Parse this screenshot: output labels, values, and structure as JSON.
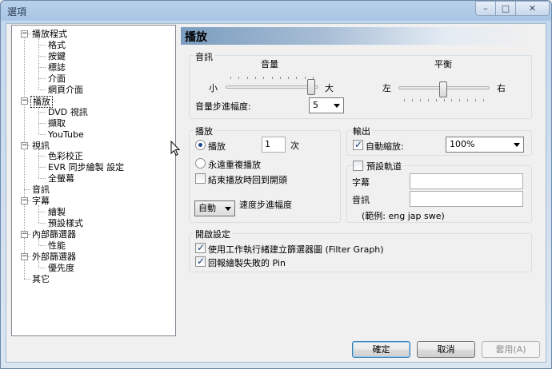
{
  "window": {
    "title": "選項"
  },
  "tree": {
    "items": [
      {
        "label": "播放程式",
        "level": 0,
        "expanded": true
      },
      {
        "label": "格式",
        "level": 1
      },
      {
        "label": "按鍵",
        "level": 1
      },
      {
        "label": "標誌",
        "level": 1
      },
      {
        "label": "介面",
        "level": 1
      },
      {
        "label": "網頁介面",
        "level": 1
      },
      {
        "label": "播放",
        "level": 0,
        "expanded": true,
        "selected": true
      },
      {
        "label": "DVD 視訊",
        "level": 1
      },
      {
        "label": "擷取",
        "level": 1
      },
      {
        "label": "YouTube",
        "level": 1
      },
      {
        "label": "視訊",
        "level": 0,
        "expanded": true
      },
      {
        "label": "色彩校正",
        "level": 1
      },
      {
        "label": "EVR 同步繪製 設定",
        "level": 1
      },
      {
        "label": "全螢幕",
        "level": 1
      },
      {
        "label": "音訊",
        "level": 0
      },
      {
        "label": "字幕",
        "level": 0,
        "expanded": true
      },
      {
        "label": "繪製",
        "level": 1
      },
      {
        "label": "預設樣式",
        "level": 1
      },
      {
        "label": "內部篩選器",
        "level": 0,
        "expanded": true
      },
      {
        "label": "性能",
        "level": 1
      },
      {
        "label": "外部篩選器",
        "level": 0,
        "expanded": true
      },
      {
        "label": "優先度",
        "level": 1
      },
      {
        "label": "其它",
        "level": 0
      }
    ]
  },
  "panel": {
    "title": "播放",
    "audio": {
      "group_label": "音訊",
      "volume_label": "音量",
      "volume_min": "小",
      "volume_max": "大",
      "volume_level": 1.0,
      "balance_label": "平衡",
      "balance_left": "左",
      "balance_right": "右",
      "balance_level": 0.5,
      "step_label": "音量步進幅度:",
      "step_value": "5"
    },
    "playback": {
      "group_label": "播放",
      "play_label": "播放",
      "play_count": "1",
      "times_label": "次",
      "repeat_forever_label": "永遠重複播放",
      "rewind_label": "結束播放時回到開頭",
      "speed_value": "自動",
      "speed_label": "速度步進幅度"
    },
    "output": {
      "group_label": "輸出",
      "autozoom_label": "自動縮放:",
      "autozoom_value": "100%"
    },
    "default_track": {
      "group_label": "預設軌道",
      "subtitle_label": "字幕",
      "audio_label": "音訊",
      "example": "(範例: eng jap swe)"
    },
    "open_settings": {
      "group_label": "開啟設定",
      "worker_thread_label": "使用工作執行緒建立篩選器圖 (Filter Graph)",
      "report_failed_label": "回報繪製失敗的 Pin"
    }
  },
  "buttons": {
    "ok": "確定",
    "cancel": "取消",
    "apply": "套用(A)"
  }
}
